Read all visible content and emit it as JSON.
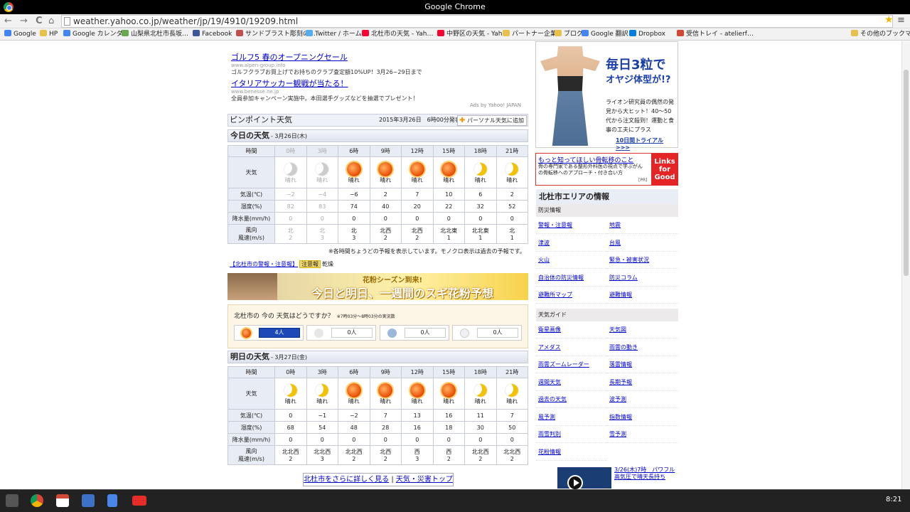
{
  "window": {
    "title": "Google Chrome"
  },
  "browser": {
    "url": "weather.yahoo.co.jp/weather/jp/19/4910/19209.html",
    "back": "←",
    "forward": "→",
    "reload": "C"
  },
  "bookmarks": [
    {
      "label": "Google",
      "color": "#4285f4"
    },
    {
      "label": "HP",
      "color": "#e8c04a"
    },
    {
      "label": "Google カレンダー",
      "color": "#4285f4"
    },
    {
      "label": "山梨県北杜市長坂…",
      "color": "#6aa84f"
    },
    {
      "label": "Facebook",
      "color": "#3b5998"
    },
    {
      "label": "サンドブラスト彫刻の…",
      "color": "#c0504d"
    },
    {
      "label": "Twitter / ホーム",
      "color": "#55acee"
    },
    {
      "label": "北杜市の天気 - Yah…",
      "color": "#ff0033"
    },
    {
      "label": "中野区の天気 - Yah…",
      "color": "#ff0033"
    },
    {
      "label": "パートナー企業",
      "color": "#e8c04a"
    },
    {
      "label": "ブログ",
      "color": "#e8c04a"
    },
    {
      "label": "Google 翻訳",
      "color": "#4285f4"
    },
    {
      "label": "Dropbox",
      "color": "#007ee5"
    },
    {
      "label": "受信トレイ - atelierf…",
      "color": "#d14836"
    },
    {
      "label": "その他のブックマーク",
      "color": "#e8c04a"
    }
  ],
  "ads": [
    {
      "title": "ゴルフ5 春のオープニングセール",
      "url": "www.alpen-group.info",
      "desc": "ゴルフクラブお買上げでお持ちのクラブ査定額10%UP！3月26~29日まで"
    },
    {
      "title": "イタリアサッカー観戦が当たる！",
      "url": "www.benesse.ne.jp",
      "desc": "全員参加キャンペーン実施中。本田選手グッズなどを抽選でプレゼント！"
    }
  ],
  "ads_by": "Ads by Yahoo! JAPAN",
  "pinpoint": {
    "title": "ピンポイント天気",
    "date": "2015年3月26日　6時00分発表",
    "button": "パーソナル天気に追加"
  },
  "today": {
    "title": "今日の天気",
    "date": "- 3月26日(木)",
    "times": [
      "0時",
      "3時",
      "6時",
      "9時",
      "12時",
      "15時",
      "18時",
      "21時"
    ],
    "icons": [
      "moon-cloud-icon",
      "moon-cloud-icon",
      "sun-icon",
      "sun-icon",
      "sun-icon",
      "sun-icon",
      "moon-icon",
      "moon-icon"
    ],
    "weather": [
      "晴れ",
      "晴れ",
      "晴れ",
      "晴れ",
      "晴れ",
      "晴れ",
      "晴れ",
      "晴れ"
    ],
    "temp": [
      "−2",
      "−4",
      "−6",
      "2",
      "7",
      "10",
      "6",
      "2"
    ],
    "humidity": [
      "82",
      "83",
      "74",
      "40",
      "20",
      "22",
      "32",
      "52"
    ],
    "precip": [
      "0",
      "0",
      "0",
      "0",
      "0",
      "0",
      "0",
      "0"
    ],
    "wind_dir": [
      "北",
      "北",
      "北",
      "北西",
      "北西",
      "北北東",
      "北北東",
      "北"
    ],
    "wind_speed": [
      "2",
      "3",
      "3",
      "2",
      "2",
      "1",
      "1",
      "1"
    ],
    "past": [
      true,
      true,
      false,
      false,
      false,
      false,
      false,
      false
    ]
  },
  "labels": {
    "time": "時間",
    "weather": "天気",
    "temp": "気温(℃)",
    "humidity": "湿度(%)",
    "precip": "降水量(mm/h)",
    "wind1": "風向",
    "wind2": "風速(m/s)"
  },
  "note": "※各時間ちょうどの予報を表示しています。モノクロ表示は過去の予報です。",
  "warning": {
    "link": "【北杜市の警報・注意報】",
    "badge": "注意報",
    "text": "乾燥"
  },
  "pollen": {
    "line1": "花粉シーズン到来!",
    "line2": "今日と明日、一週間のスギ花粉予想"
  },
  "survey": {
    "question": "北杜市の 今の 天気はどうですか？",
    "note": "※7時03分～8時03分の実況数",
    "votes": [
      "4人",
      "0人",
      "0人",
      "0人"
    ]
  },
  "tomorrow": {
    "title": "明日の天気",
    "date": "- 3月27日(金)",
    "times": [
      "0時",
      "3時",
      "6時",
      "9時",
      "12時",
      "15時",
      "18時",
      "21時"
    ],
    "icons": [
      "moon-icon",
      "moon-icon",
      "sun-icon",
      "sun-icon",
      "sun-icon",
      "sun-icon",
      "moon-icon",
      "moon-icon"
    ],
    "weather": [
      "晴れ",
      "晴れ",
      "晴れ",
      "晴れ",
      "晴れ",
      "晴れ",
      "晴れ",
      "晴れ"
    ],
    "temp": [
      "0",
      "−1",
      "−2",
      "7",
      "13",
      "16",
      "11",
      "7"
    ],
    "humidity": [
      "68",
      "54",
      "48",
      "28",
      "16",
      "18",
      "30",
      "50"
    ],
    "precip": [
      "0",
      "0",
      "0",
      "0",
      "0",
      "0",
      "0",
      "0"
    ],
    "wind_dir": [
      "北北西",
      "北北西",
      "北北西",
      "北西",
      "西",
      "西",
      "北北西",
      "北北西"
    ],
    "wind_speed": [
      "2",
      "3",
      "2",
      "2",
      "3",
      "2",
      "2",
      "2"
    ],
    "past": [
      false,
      false,
      false,
      false,
      false,
      false,
      false,
      false
    ]
  },
  "bottom_links": {
    "a": "北杜市をさらに詳しく見る",
    "sep": "|",
    "b": "天気・災害トップ"
  },
  "right_ad": {
    "h1": "毎日3粒で",
    "h2": "オヤジ体型が!?",
    "p": "ライオン研究員の偶然の発見から大ヒット！40～50代から注文殺到！運動と食事の工夫にプラス",
    "cta": "10日間トライアル >>>"
  },
  "right_ad2": {
    "title": "もっと知ってほしい骨転移のこと",
    "desc": "骨の専門家である整形外科医の視点で学ぶがんの骨転移へのアプローチ・付き合い方",
    "pr": "[PR]",
    "logo": "Links for Good"
  },
  "area": {
    "title": "北杜市エリアの情報",
    "bousai": {
      "title": "防災情報",
      "items": [
        "警報・注意報",
        "地震",
        "津波",
        "台風",
        "火山",
        "緊急・被害状況",
        "自治体の防災情報",
        "防災コラム",
        "避難所マップ",
        "避難情報"
      ]
    },
    "guide": {
      "title": "天気ガイド",
      "items": [
        "衛星画像",
        "天気図",
        "アメダス",
        "雨雲の動き",
        "雨雲ズームレーダー",
        "落雷情報",
        "週間天気",
        "長期予報",
        "過去の天気",
        "波予測",
        "風予測",
        "指数情報",
        "雨雪判別",
        "雪予測",
        "花粉情報"
      ]
    }
  },
  "video": {
    "title": "3/26(木)7時　パワフル高気圧で晴天長持ち"
  },
  "clock": "8:21"
}
